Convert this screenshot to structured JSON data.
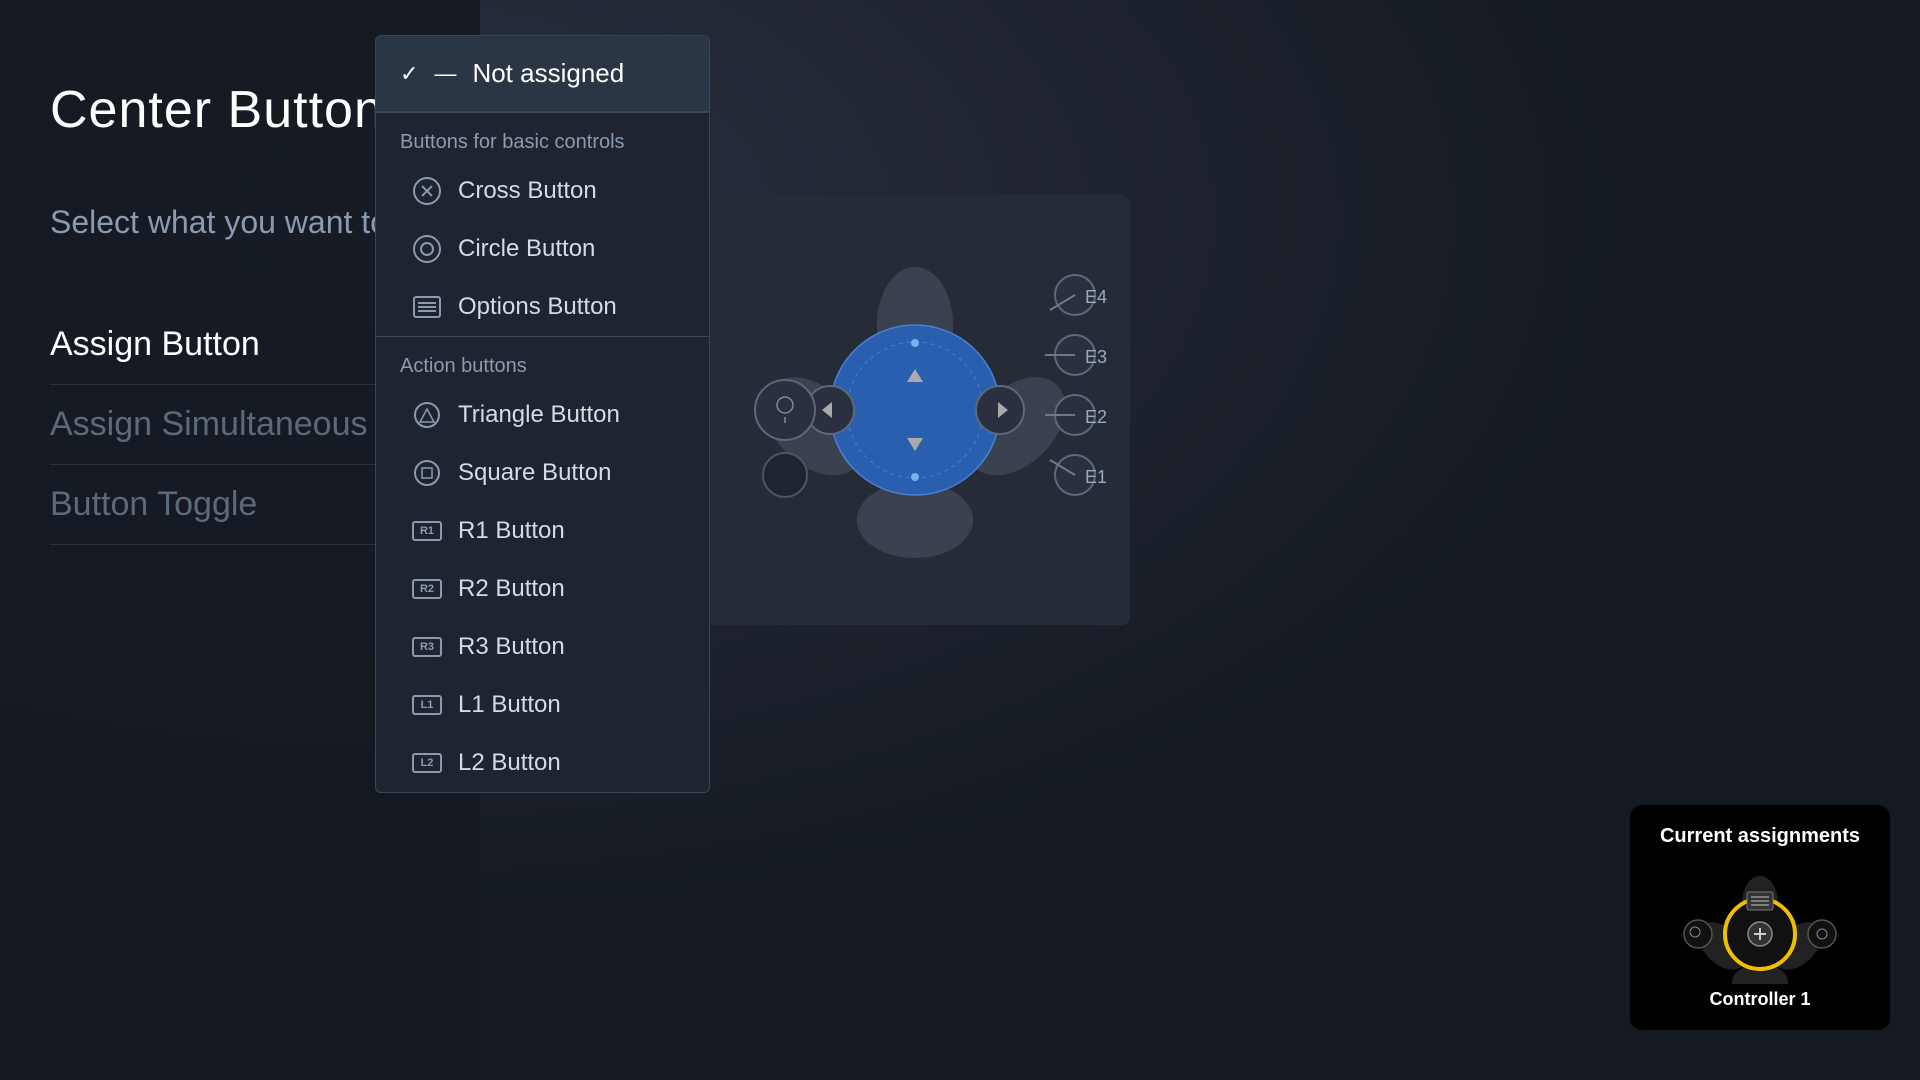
{
  "background": {
    "color": "#1a1f26"
  },
  "left_panel": {
    "title": "Center Button",
    "description": "Select what you want to a",
    "menu_items": [
      {
        "id": "assign-button",
        "label": "Assign Button",
        "active": true,
        "muted": false
      },
      {
        "id": "assign-simultaneous",
        "label": "Assign Simultaneous Pre",
        "active": false,
        "muted": true
      },
      {
        "id": "button-toggle",
        "label": "Button Toggle",
        "active": false,
        "muted": true
      }
    ]
  },
  "dropdown": {
    "not_assigned": {
      "label": "Not assigned",
      "checked": true
    },
    "sections": [
      {
        "id": "basic-controls",
        "label": "Buttons for basic controls",
        "items": [
          {
            "id": "cross-button",
            "label": "Cross Button",
            "icon": "cross"
          },
          {
            "id": "circle-button",
            "label": "Circle Button",
            "icon": "circle"
          },
          {
            "id": "options-button",
            "label": "Options Button",
            "icon": "options"
          }
        ]
      },
      {
        "id": "action-buttons",
        "label": "Action buttons",
        "items": [
          {
            "id": "triangle-button",
            "label": "Triangle Button",
            "icon": "triangle"
          },
          {
            "id": "square-button",
            "label": "Square Button",
            "icon": "square"
          },
          {
            "id": "r1-button",
            "label": "R1 Button",
            "icon": "R1"
          },
          {
            "id": "r2-button",
            "label": "R2 Button",
            "icon": "R2"
          },
          {
            "id": "r3-button",
            "label": "R3 Button",
            "icon": "R3"
          },
          {
            "id": "l1-button",
            "label": "L1 Button",
            "icon": "L1"
          },
          {
            "id": "l2-button",
            "label": "L2 Button",
            "icon": "L2"
          }
        ]
      }
    ]
  },
  "current_assignments": {
    "title": "Current assignments",
    "controller_label": "Controller 1"
  }
}
